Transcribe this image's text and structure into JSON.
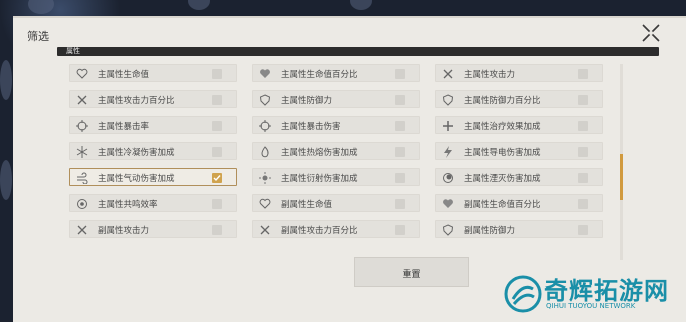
{
  "dialog": {
    "title": "筛选",
    "section_label": "属性",
    "reset_label": "重置"
  },
  "options": [
    {
      "label": "主属性生命值",
      "icon": "heart-icon",
      "checked": false
    },
    {
      "label": "主属性生命值百分比",
      "icon": "heart-percent-icon",
      "checked": false
    },
    {
      "label": "主属性攻击力",
      "icon": "crossed-swords-icon",
      "checked": false
    },
    {
      "label": "主属性攻击力百分比",
      "icon": "crossed-swords-icon",
      "checked": false
    },
    {
      "label": "主属性防御力",
      "icon": "shield-icon",
      "checked": false
    },
    {
      "label": "主属性防御力百分比",
      "icon": "shield-icon",
      "checked": false
    },
    {
      "label": "主属性暴击率",
      "icon": "crosshair-icon",
      "checked": false
    },
    {
      "label": "主属性暴击伤害",
      "icon": "crosshair-icon",
      "checked": false
    },
    {
      "label": "主属性治疗效果加成",
      "icon": "cross-icon",
      "checked": false
    },
    {
      "label": "主属性冷凝伤害加成",
      "icon": "snowflake-icon",
      "checked": false
    },
    {
      "label": "主属性热熔伤害加成",
      "icon": "flame-icon",
      "checked": false
    },
    {
      "label": "主属性导电伤害加成",
      "icon": "lightning-icon",
      "checked": false
    },
    {
      "label": "主属性气动伤害加成",
      "icon": "wind-icon",
      "checked": true
    },
    {
      "label": "主属性衍射伤害加成",
      "icon": "sun-icon",
      "checked": false
    },
    {
      "label": "主属性湮灭伤害加成",
      "icon": "void-icon",
      "checked": false
    },
    {
      "label": "主属性共鸣效率",
      "icon": "eye-icon",
      "checked": false
    },
    {
      "label": "副属性生命值",
      "icon": "heart-icon",
      "checked": false
    },
    {
      "label": "副属性生命值百分比",
      "icon": "heart-percent-icon",
      "checked": false
    },
    {
      "label": "副属性攻击力",
      "icon": "crossed-swords-icon",
      "checked": false
    },
    {
      "label": "副属性攻击力百分比",
      "icon": "crossed-swords-icon",
      "checked": false
    },
    {
      "label": "副属性防御力",
      "icon": "shield-icon",
      "checked": false
    }
  ],
  "watermark": {
    "text": "奇辉拓游网",
    "subtext": "QIHUI TUOYOU NETWORK",
    "color": "#1a8fa8"
  },
  "scroll": {
    "position_fraction": 0.47
  }
}
